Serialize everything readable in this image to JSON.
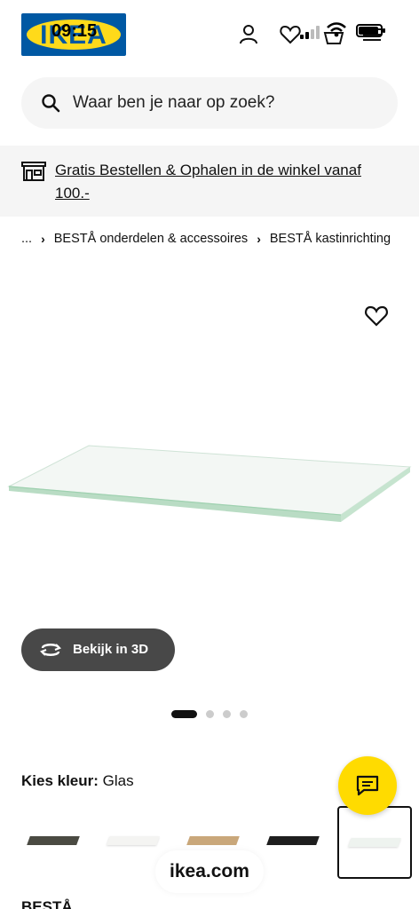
{
  "status_bar": {
    "time": "09:15"
  },
  "header": {
    "logo_text": "IKEA"
  },
  "search": {
    "placeholder": "Waar ben je naar op zoek?"
  },
  "banner": {
    "text": "Gratis Bestellen & Ophalen in de winkel vanaf 100.-"
  },
  "breadcrumb": {
    "ellipsis": "...",
    "items": [
      "BESTÅ onderdelen & accessoires",
      "BESTÅ kastinrichting"
    ]
  },
  "product": {
    "view3d_label": "Bekijk in 3D",
    "image_count": 4,
    "active_image": 1,
    "colour_label": "Kies kleur:",
    "colour_value": "Glas",
    "swatches": [
      {
        "name": "grijsgroen",
        "color": "#4a4a42"
      },
      {
        "name": "wit",
        "color": "#f4f4f2"
      },
      {
        "name": "eikeneffect",
        "color": "#c9a77a"
      },
      {
        "name": "zwartbruin",
        "color": "#1e1e1e"
      },
      {
        "name": "glas",
        "color": "#eef3ef",
        "selected": true
      }
    ],
    "title": "BESTÅ"
  },
  "browser": {
    "domain": "ikea.com"
  },
  "colors": {
    "ikea_blue": "#0058a3",
    "ikea_yellow": "#ffda1a",
    "chat_yellow": "#ffdb00"
  }
}
